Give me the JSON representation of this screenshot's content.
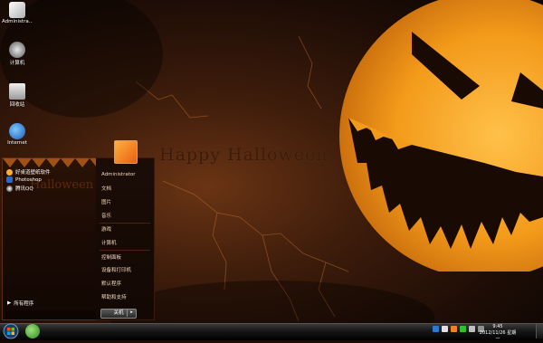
{
  "desktop": {
    "greeting": "Happy Halloween",
    "icons": [
      {
        "label": "Administra...",
        "icon": "user-folder-icon"
      },
      {
        "label": "计算机",
        "icon": "computer-icon"
      },
      {
        "label": "回收站",
        "icon": "recycle-bin-icon"
      },
      {
        "label": "Internet",
        "icon": "internet-explorer-icon"
      }
    ]
  },
  "start_menu": {
    "pinned": [
      {
        "label": "好桌道壁纸软件",
        "icon": "wallpaper-app-icon"
      },
      {
        "label": "Photoshop",
        "icon": "photoshop-icon"
      },
      {
        "label": "腾讯QQ",
        "icon": "qq-icon"
      }
    ],
    "left_decor": "Halloween",
    "all_programs": "所有程序",
    "right_links": [
      {
        "label": "Administrator"
      },
      {
        "label": "文档"
      },
      {
        "label": "图片"
      },
      {
        "label": "音乐"
      },
      {
        "label": "游戏"
      },
      {
        "label": "计算机"
      },
      {
        "label": "控制面板"
      },
      {
        "label": "设备和打印机"
      },
      {
        "label": "默认程序"
      },
      {
        "label": "帮助和支持"
      }
    ],
    "shutdown_label": "关机",
    "shutdown_arrow": "▸"
  },
  "taskbar": {
    "time": "9:45",
    "date": "2012/11/26 星期一"
  },
  "colors": {
    "accent": "#f0a020",
    "pumpkin": "#f5a623",
    "background": "#2a1408"
  }
}
